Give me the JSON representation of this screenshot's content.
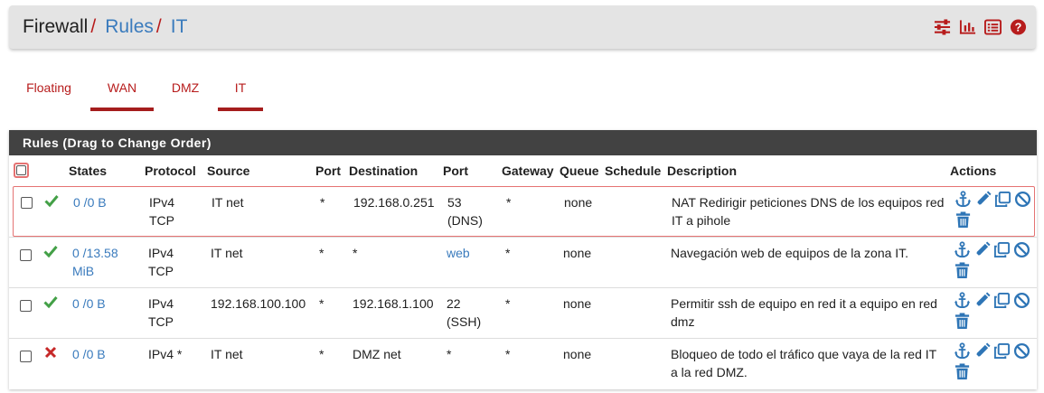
{
  "breadcrumb": {
    "first": "Firewall",
    "sep": "/",
    "second": "Rules",
    "third": "IT"
  },
  "toolbar_icons": [
    "sliders-icon",
    "bar-chart-icon",
    "list-icon",
    "help-icon"
  ],
  "tabs": [
    {
      "label": "Floating",
      "active": false
    },
    {
      "label": "WAN",
      "active": true
    },
    {
      "label": "DMZ",
      "active": false
    },
    {
      "label": "IT",
      "active": true
    }
  ],
  "panel": {
    "title": "Rules (Drag to Change Order)"
  },
  "columns": [
    "States",
    "Protocol",
    "Source",
    "Port",
    "Destination",
    "Port",
    "Gateway",
    "Queue",
    "Schedule",
    "Description",
    "Actions"
  ],
  "rules": [
    {
      "status": "pass",
      "states": "0 /0 B",
      "protocol_1": "IPv4",
      "protocol_2": "TCP",
      "source": "IT net",
      "src_port": "*",
      "destination": "192.168.0.251",
      "dst_port_1": "53",
      "dst_port_2": "(DNS)",
      "dst_port_link": false,
      "gateway": "*",
      "queue": "none",
      "schedule": "",
      "description": "NAT Redirigir peticiones DNS de los equipos red IT a pihole"
    },
    {
      "status": "pass",
      "states": "0 /13.58 MiB",
      "protocol_1": "IPv4",
      "protocol_2": "TCP",
      "source": "IT net",
      "src_port": "*",
      "destination": "*",
      "dst_port_1": "web",
      "dst_port_2": "",
      "dst_port_link": true,
      "gateway": "*",
      "queue": "none",
      "schedule": "",
      "description": "Navegación web de equipos de la zona IT."
    },
    {
      "status": "pass",
      "states": "0 /0 B",
      "protocol_1": "IPv4",
      "protocol_2": "TCP",
      "source": "192.168.100.100",
      "src_port": "*",
      "destination": "192.168.1.100",
      "dst_port_1": "22",
      "dst_port_2": "(SSH)",
      "dst_port_link": false,
      "gateway": "*",
      "queue": "none",
      "schedule": "",
      "description": "Permitir ssh de equipo en red it a equipo en red dmz"
    },
    {
      "status": "block",
      "states": "0 /0 B",
      "protocol_1": "IPv4 *",
      "protocol_2": "",
      "source": "IT net",
      "src_port": "*",
      "destination": "DMZ net",
      "dst_port_1": "*",
      "dst_port_2": "",
      "dst_port_link": false,
      "gateway": "*",
      "queue": "none",
      "schedule": "",
      "description": "Bloqueo de todo el tráfico que vaya de la red IT a la red DMZ."
    }
  ],
  "row_actions": [
    "anchor-icon",
    "edit-icon",
    "copy-icon",
    "disable-icon",
    "delete-icon"
  ],
  "colors": {
    "brand_red": "#b71c1c",
    "link_blue": "#3a7bbd",
    "pass_green": "#43a047",
    "block_red": "#c62828",
    "header_dark": "#424242"
  }
}
